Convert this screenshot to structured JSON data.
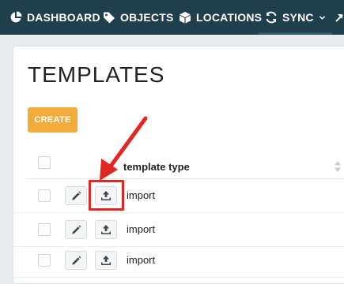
{
  "nav": {
    "items": [
      {
        "label": "DASHBOARD",
        "icon": "pie-chart-icon"
      },
      {
        "label": "OBJECTS",
        "icon": "tag-icon"
      },
      {
        "label": "LOCATIONS",
        "icon": "cube-icon"
      },
      {
        "label": "SYNC",
        "icon": "sync-icon",
        "active": true
      }
    ]
  },
  "page": {
    "title": "TEMPLATES",
    "create_label": "CREATE"
  },
  "table": {
    "columns": [
      "template type"
    ],
    "rows": [
      {
        "type": "import"
      },
      {
        "type": "import"
      },
      {
        "type": "import"
      }
    ]
  },
  "colors": {
    "nav_bg": "#1f3f4d",
    "create_button": "#f3ac3b",
    "annotation": "#e3261f"
  }
}
